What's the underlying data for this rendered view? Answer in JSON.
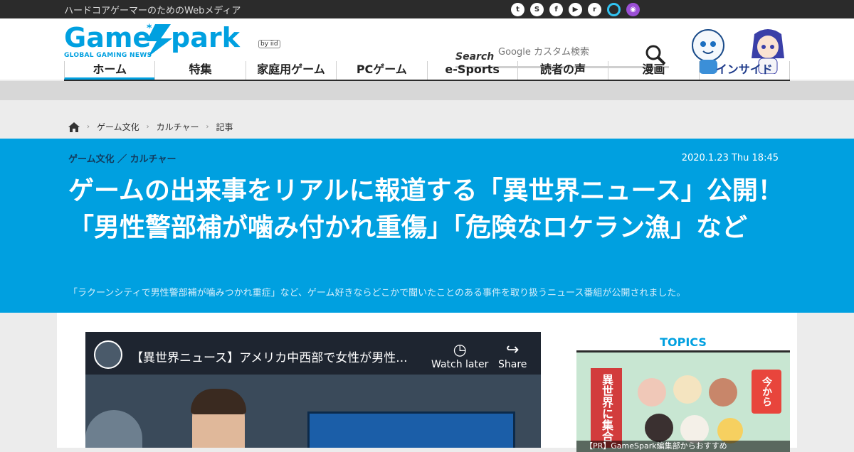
{
  "topbar": {
    "tagline": "ハードコアゲーマーのためのWebメディア",
    "social": [
      {
        "name": "twitter-icon",
        "glyph": "t"
      },
      {
        "name": "steam-icon",
        "glyph": "S"
      },
      {
        "name": "facebook-icon",
        "glyph": "f"
      },
      {
        "name": "youtube-icon",
        "glyph": "▶"
      },
      {
        "name": "rss-icon",
        "glyph": "r"
      },
      {
        "name": "alexa-icon",
        "glyph": ""
      },
      {
        "name": "podcast-icon",
        "glyph": "◉"
      }
    ]
  },
  "header": {
    "logo_text": "Game*Spark",
    "logo_sub": "GLOBAL GAMING NEWS",
    "logo_byline": "by iid",
    "search_label": "Search",
    "search_placeholder": "Google カスタム検索"
  },
  "nav": {
    "items": [
      "ホーム",
      "特集",
      "家庭用ゲーム",
      "PCゲーム",
      "e-Sports",
      "読者の声",
      "漫画",
      "インサイド"
    ]
  },
  "breadcrumb": {
    "items": [
      "ゲーム文化",
      "カルチャー",
      "記事"
    ]
  },
  "article": {
    "category": "ゲーム文化 ／ カルチャー",
    "date": "2020.1.23 Thu 18:45",
    "title": "ゲームの出来事をリアルに報道する「異世界ニュース」公開！「男性警部補が噛み付かれ重傷」「危険なロケラン漁」など",
    "lead": "「ラクーンシティで男性警部補が噛みつかれ重症」など、ゲーム好きならどこかで聞いたことのある事件を取り扱うニュース番組が公開されました。"
  },
  "video": {
    "title": "【異世界ニュース】アメリカ中西部で女性が男性...",
    "watch_later": "Watch later",
    "share": "Share"
  },
  "sidebar": {
    "topics_heading": "TOPICS",
    "banner_left": "異世界に集合",
    "banner_right": "今から",
    "caption": "【PR】GameSpark編集部からおすすめ"
  },
  "colors": {
    "brand_blue": "#00a0e0",
    "topbar": "#2b2b2b",
    "nav_inside": "#1d3a8a"
  }
}
